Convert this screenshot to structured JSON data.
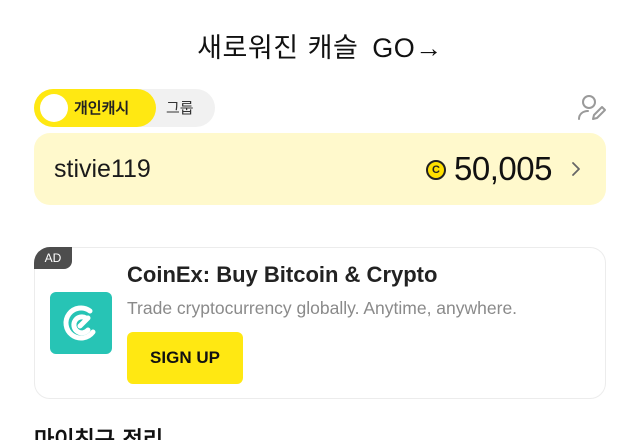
{
  "header": {
    "title": "새로워진 캐슬",
    "go_label": "GO→"
  },
  "cash_toggle": {
    "active_label": "개인캐시",
    "inactive_label": "그룹"
  },
  "account": {
    "username": "stivie119",
    "coin_symbol": "C",
    "balance": "50,005"
  },
  "ad": {
    "badge": "AD",
    "title": "CoinEx: Buy Bitcoin & Crypto",
    "description": "Trade cryptocurrency globally. Anytime, anywhere.",
    "cta_label": "SIGN UP",
    "logo_color": "#27c4b5"
  },
  "next_section": {
    "title_partial": "마이친구 정리"
  },
  "colors": {
    "accent_yellow": "#ffe812",
    "card_yellow": "#fff9cc"
  },
  "icons": {
    "profile_edit": "person-edit-icon",
    "chevron": "chevron-right-icon",
    "coin": "coin-icon"
  }
}
